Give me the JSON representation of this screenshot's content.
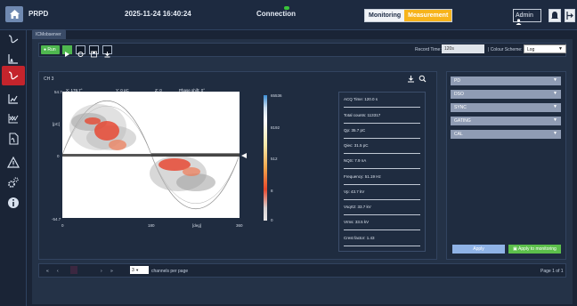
{
  "app": {
    "title": "PRPD",
    "datetime": "2025-11-24 16:40:24",
    "connection": "Connection"
  },
  "mode": {
    "monitoring": "Monitoring",
    "measurement": "Measurement"
  },
  "user": {
    "label": "Admin"
  },
  "tab": {
    "label": "ICMobserver"
  },
  "toolbar": {
    "run": "Run",
    "record_label": "Record Time:",
    "record_value": "120s",
    "scheme_label": "| Colour Scheme:",
    "scheme_value": "Log"
  },
  "plot": {
    "channel": "CH 3",
    "readout": {
      "x": "X: 178.7°",
      "y": "Y: 0 pC",
      "z": "Z: 0",
      "phase": "Phase shift: 0°"
    },
    "y_top": "54.7",
    "y_unit": "[pC]",
    "y_zero": "0",
    "y_bottom": "-54.7",
    "x_ticks": [
      "0",
      "180",
      "360"
    ],
    "x_unit": "[deg]"
  },
  "colorbar": [
    "65536",
    "8192",
    "512",
    "8",
    "0"
  ],
  "stats": [
    "ACQ Time: 120.0 s",
    "Total counts: 113317",
    "Qp: 35.7 pC",
    "Qiec: 31.5 pC",
    "NQS: 7.9 nA",
    "Frequency: 51.19 Hz",
    "Vp: 43.7 kV",
    "Vsqrt2: 33.7 kV",
    "Vrms: 33.5 kV",
    "Crest factor: 1.43"
  ],
  "accordions": [
    "PD",
    "DSO",
    "SYNC",
    "GATING",
    "CAL"
  ],
  "buttons": {
    "apply": "Apply",
    "apply_monitoring": "Apply to monitoring"
  },
  "pager": {
    "first": "«",
    "prev": "‹",
    "next": "›",
    "last": "»",
    "per_page_value": "3",
    "per_page_label": "channels per page",
    "page": "Page 1 of 1"
  },
  "colors": {
    "accent": "#f7b41c",
    "active_nav": "#c4242c",
    "run": "#4fb74f"
  }
}
